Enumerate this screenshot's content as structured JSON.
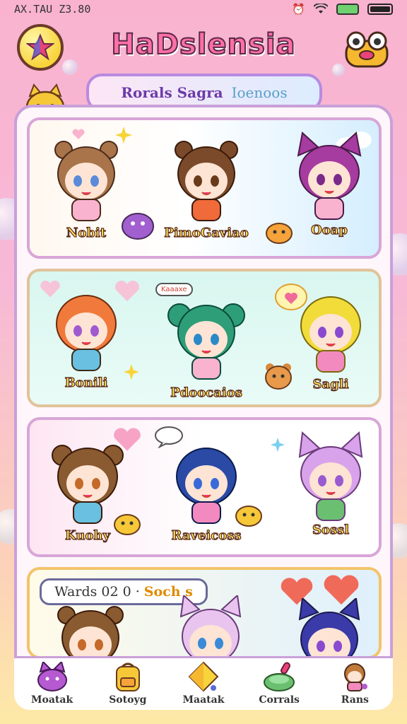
{
  "status_bar": {
    "time": "AX.TAU Z3.80"
  },
  "header": {
    "title": "HaDslensia",
    "left_button_icon": "star-icon",
    "right_button_icon": "frog-face-icon"
  },
  "search": {
    "label_primary": "Rorals Sagra",
    "label_secondary": "Ioenoos"
  },
  "rows": [
    {
      "characters": [
        {
          "name": "Nobit",
          "hair": "#a9744a",
          "ear": "bear"
        },
        {
          "name": "PimoGaviao",
          "hair": "#7a4a2a",
          "ear": "bear"
        },
        {
          "name": "Ooap",
          "hair": "#a63ba0",
          "ear": "cat"
        }
      ]
    },
    {
      "characters": [
        {
          "name": "Bonili",
          "hair": "#f07a3c",
          "ear": "none"
        },
        {
          "name": "Pdoocaios",
          "hair": "#2e9e78",
          "ear": "buns"
        },
        {
          "name": "Sagli",
          "hair": "#f2dc3a",
          "ear": "none"
        }
      ]
    },
    {
      "characters": [
        {
          "name": "Kuohy",
          "hair": "#8a5a30",
          "ear": "bear"
        },
        {
          "name": "Raveicoss",
          "hair": "#2a4aa6",
          "ear": "none"
        },
        {
          "name": "Sossl",
          "hair": "#d8a3ea",
          "ear": "cat"
        }
      ]
    }
  ],
  "bubble_text": "Kaaaxe",
  "featured": {
    "title_part1": "Wards 02 0",
    "title_part2": "Soch s",
    "characters": [
      {
        "hair": "#8a5a30",
        "ear": "bear"
      },
      {
        "hair": "#e9c4ee",
        "ear": "cat"
      },
      {
        "hair": "#3a3aa8",
        "ear": "cat"
      }
    ]
  },
  "nav": [
    {
      "label": "Moatak",
      "icon": "cat-icon"
    },
    {
      "label": "Sotoyg",
      "icon": "backpack-icon"
    },
    {
      "label": "Maatak",
      "icon": "gem-icon"
    },
    {
      "label": "Corrals",
      "icon": "controller-icon"
    },
    {
      "label": "Rans",
      "icon": "character-icon"
    }
  ],
  "colors": {
    "background_top": "#f9b3cf",
    "title_pink": "#ff6fa8",
    "frame_border": "#c9a0d9",
    "name_yellow": "#ffe05a"
  }
}
